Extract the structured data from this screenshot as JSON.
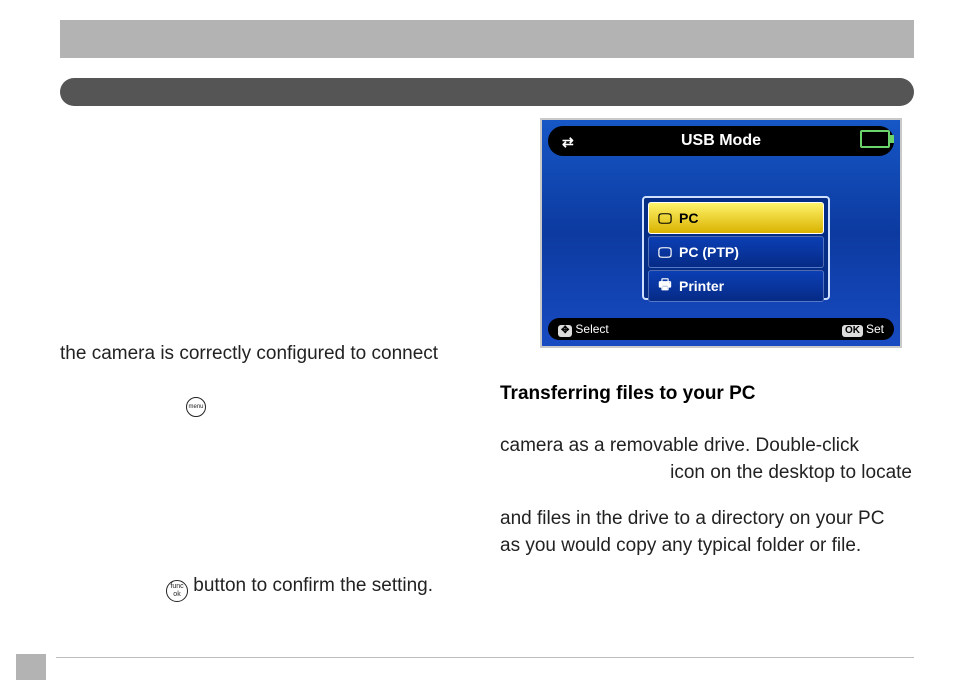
{
  "left": {
    "configured_line": "the camera is correctly configured to connect",
    "menu_icon_label": "menu",
    "func_icon_line1": "func",
    "func_icon_line2": "ok",
    "confirm_text": " button to confirm the setting."
  },
  "right": {
    "heading": "Transferring files to your PC",
    "para1_line1": "camera as a removable drive. Double-click",
    "para1_line2": "icon on the desktop to locate",
    "para2_line1": "and files in the drive to a directory on your PC",
    "para2_line2": "as you would copy any typical folder or file."
  },
  "lcd": {
    "title": "USB Mode",
    "options": {
      "pc": "PC",
      "pc_ptp": "PC (PTP)",
      "printer": "Printer"
    },
    "footer": {
      "select_btn": "✥",
      "select_label": "Select",
      "ok_btn": "OK",
      "ok_label": "Set"
    }
  }
}
